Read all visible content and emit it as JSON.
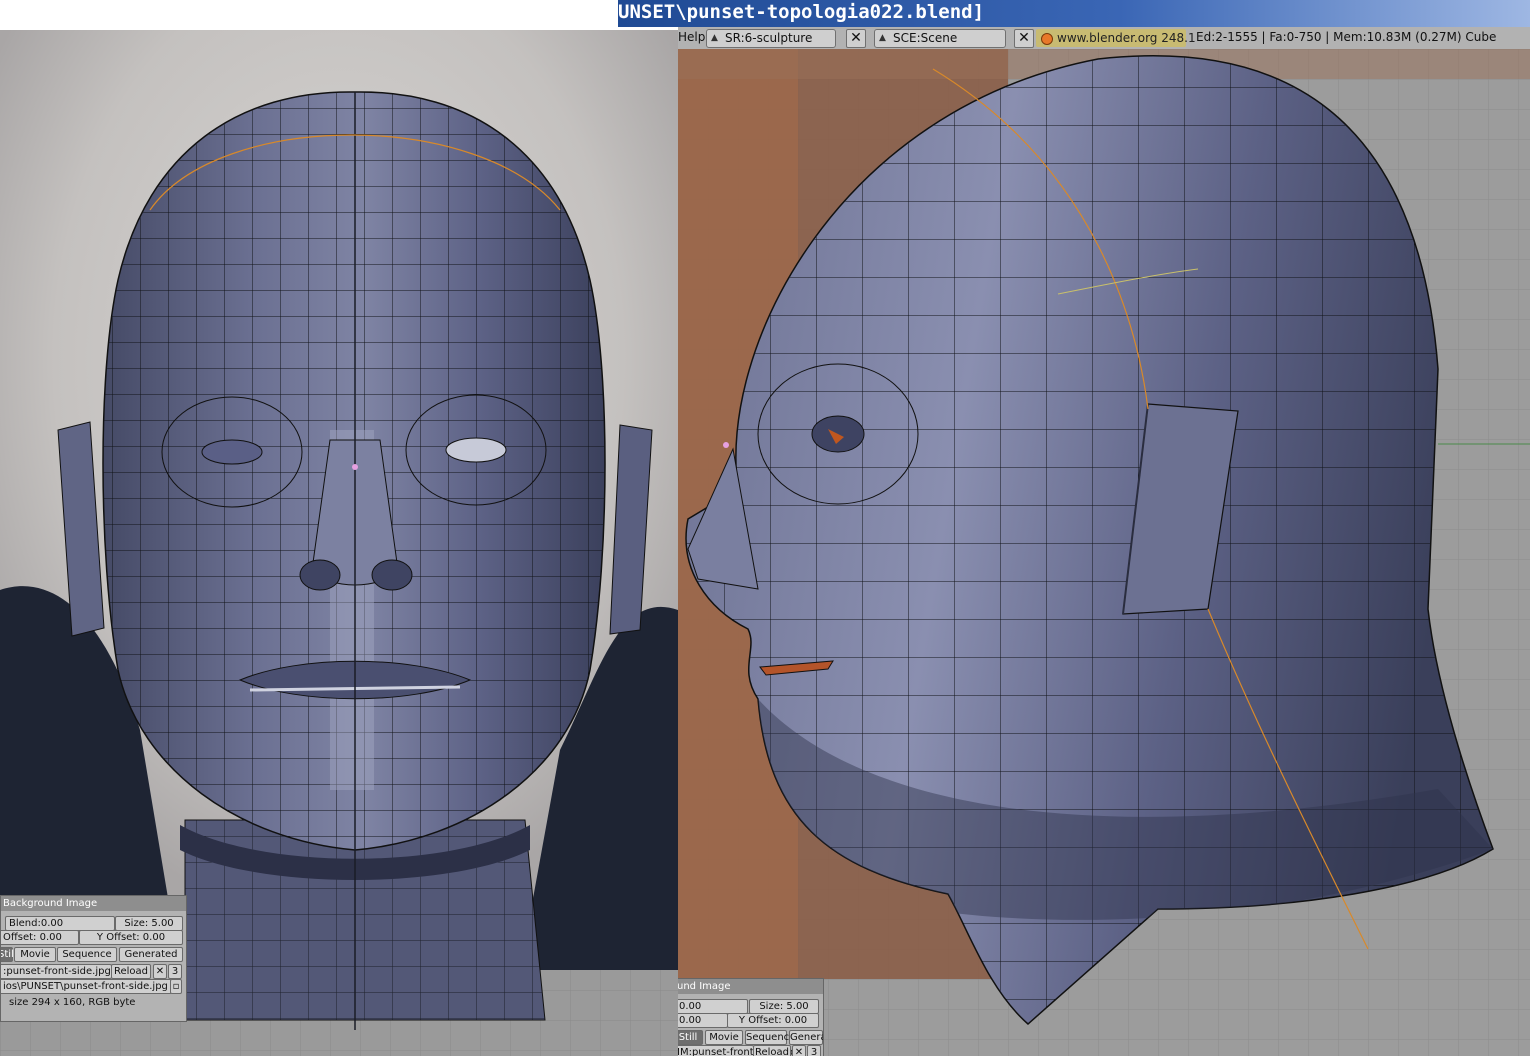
{
  "window": {
    "title": "UNSET\\punset-topologia022.blend]"
  },
  "header": {
    "help_menu": "Help",
    "screen_field": "SR:6-sculpture",
    "scene_field": "SCE:Scene",
    "web_button": "www.blender.org 248.1",
    "stats": "Ed:2-1555 | Fa:0-750 | Mem:10.83M (0.27M) Cube"
  },
  "left_panel": {
    "title": "Background Image",
    "blend": "Blend:0.00",
    "size": "Size: 5.00",
    "x_offset": "Offset: 0.00",
    "y_offset": "Y Offset: 0.00",
    "tabs": [
      "Still",
      "Movie",
      "Sequence",
      "Generated"
    ],
    "image_name": ":punset-front-side.jpg",
    "reload": "Reload",
    "users": "3",
    "path": "ios\\PUNSET\\punset-front-side.jpg",
    "info": "size 294 x 160, RGB byte"
  },
  "right_panel": {
    "title": "und Image",
    "blend": "0.00",
    "size": "Size: 5.00",
    "x_offset": "0.00",
    "y_offset": "Y Offset: 0.00",
    "tabs": [
      "Still",
      "Movie",
      "Sequence",
      "Generated"
    ],
    "image_name": "IM:punset-front-side.jpg",
    "reload": "Reload",
    "users": "3"
  },
  "colors": {
    "mesh_face": "#5b6083",
    "mesh_edge": "#111318",
    "seam": "#d8892a",
    "title_bar": "#2a57a6",
    "header_bg": "#b2b2b2"
  }
}
